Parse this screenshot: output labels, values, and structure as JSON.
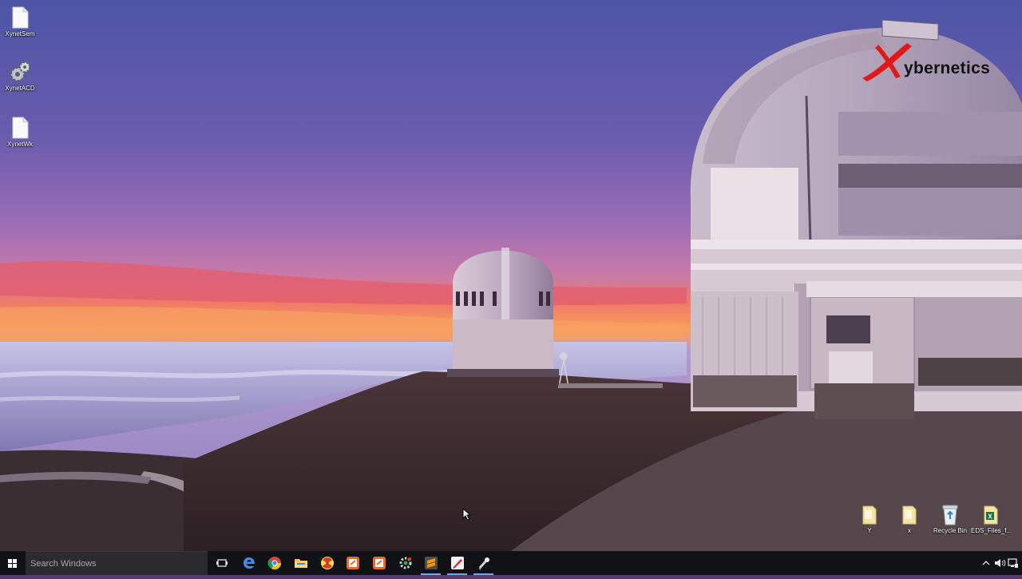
{
  "desktop": {
    "top_left_icons": [
      {
        "label": "XynetSem",
        "icon": "blank-file-icon"
      },
      {
        "label": "XynetACD",
        "icon": "gears-settings-icon"
      },
      {
        "label": "XynetWk",
        "icon": "blank-file-icon"
      }
    ],
    "bottom_right_icons": [
      {
        "label": "Y",
        "icon": "folder-icon"
      },
      {
        "label": "x",
        "icon": "folder-icon"
      },
      {
        "label": "Recycle Bin",
        "icon": "recycle-bin-icon"
      },
      {
        "label": "EDS_Files_f...",
        "icon": "excel-file-icon"
      }
    ]
  },
  "branding": {
    "logo_letter": "X",
    "logo_text": "ybernetics",
    "logo_color": "#e01818"
  },
  "taskbar": {
    "search_placeholder": "Search Windows",
    "accent": "#6fa9e6",
    "pinned_apps": [
      {
        "name": "task-view",
        "icon": "task-view-icon"
      },
      {
        "name": "edge",
        "icon": "edge-browser-icon"
      },
      {
        "name": "chrome",
        "icon": "chrome-browser-icon"
      },
      {
        "name": "file-explorer",
        "icon": "folder-icon"
      },
      {
        "name": "radiation-app",
        "icon": "radiation-icon"
      },
      {
        "name": "app-orange-1",
        "icon": "orange-square-app-icon"
      },
      {
        "name": "app-orange-2",
        "icon": "orange-square-app-icon"
      },
      {
        "name": "app-gear",
        "icon": "gear-app-icon"
      },
      {
        "name": "sublime-text",
        "icon": "sublime-text-icon"
      },
      {
        "name": "app-red-pen",
        "icon": "red-pen-app-icon"
      },
      {
        "name": "app-wand",
        "icon": "wand-app-icon"
      }
    ],
    "tray_icons": [
      "chevron-up-icon",
      "volume-icon",
      "network-icon"
    ]
  }
}
